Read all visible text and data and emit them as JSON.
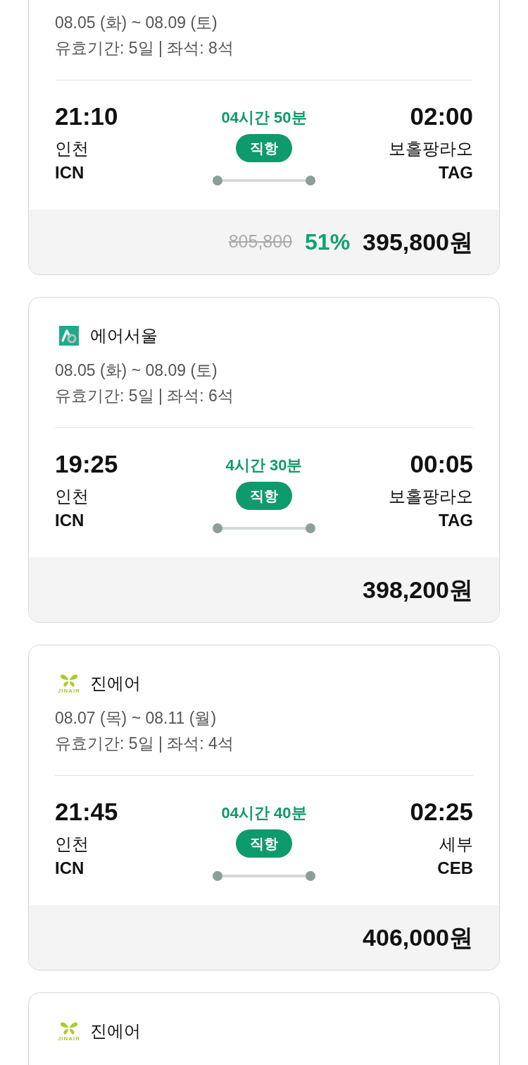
{
  "flights": [
    {
      "dates": "08.05 (화) ~ 08.09 (토)",
      "validity": "유효기간: 5일 | 좌석: 8석",
      "departure": {
        "time": "21:10",
        "city": "인천",
        "code": "ICN"
      },
      "duration": "04시간 50분",
      "route_type": "직항",
      "arrival": {
        "time": "02:00",
        "city": "보홀팡라오",
        "code": "TAG"
      },
      "price": {
        "original": "805,800",
        "discount": "51%",
        "final": "395,800원"
      }
    },
    {
      "airline": {
        "name": "에어서울",
        "logo": {
          "kind": "ring-square"
        }
      },
      "dates": "08.05 (화) ~ 08.09 (토)",
      "validity": "유효기간: 5일 | 좌석: 6석",
      "departure": {
        "time": "19:25",
        "city": "인천",
        "code": "ICN"
      },
      "duration": "4시간 30분",
      "route_type": "직항",
      "arrival": {
        "time": "00:05",
        "city": "보홀팡라오",
        "code": "TAG"
      },
      "price": {
        "final": "398,200원"
      }
    },
    {
      "airline": {
        "name": "진에어",
        "logo": {
          "kind": "butterfly",
          "wordmark": "JINAIR"
        }
      },
      "dates": "08.07 (목) ~ 08.11 (월)",
      "validity": "유효기간: 5일 | 좌석: 4석",
      "departure": {
        "time": "21:45",
        "city": "인천",
        "code": "ICN"
      },
      "duration": "04시간 40분",
      "route_type": "직항",
      "arrival": {
        "time": "02:25",
        "city": "세부",
        "code": "CEB"
      },
      "price": {
        "final": "406,000원"
      }
    },
    {
      "airline": {
        "name": "진에어",
        "logo": {
          "kind": "butterfly",
          "wordmark": "JINAIR"
        }
      }
    }
  ]
}
